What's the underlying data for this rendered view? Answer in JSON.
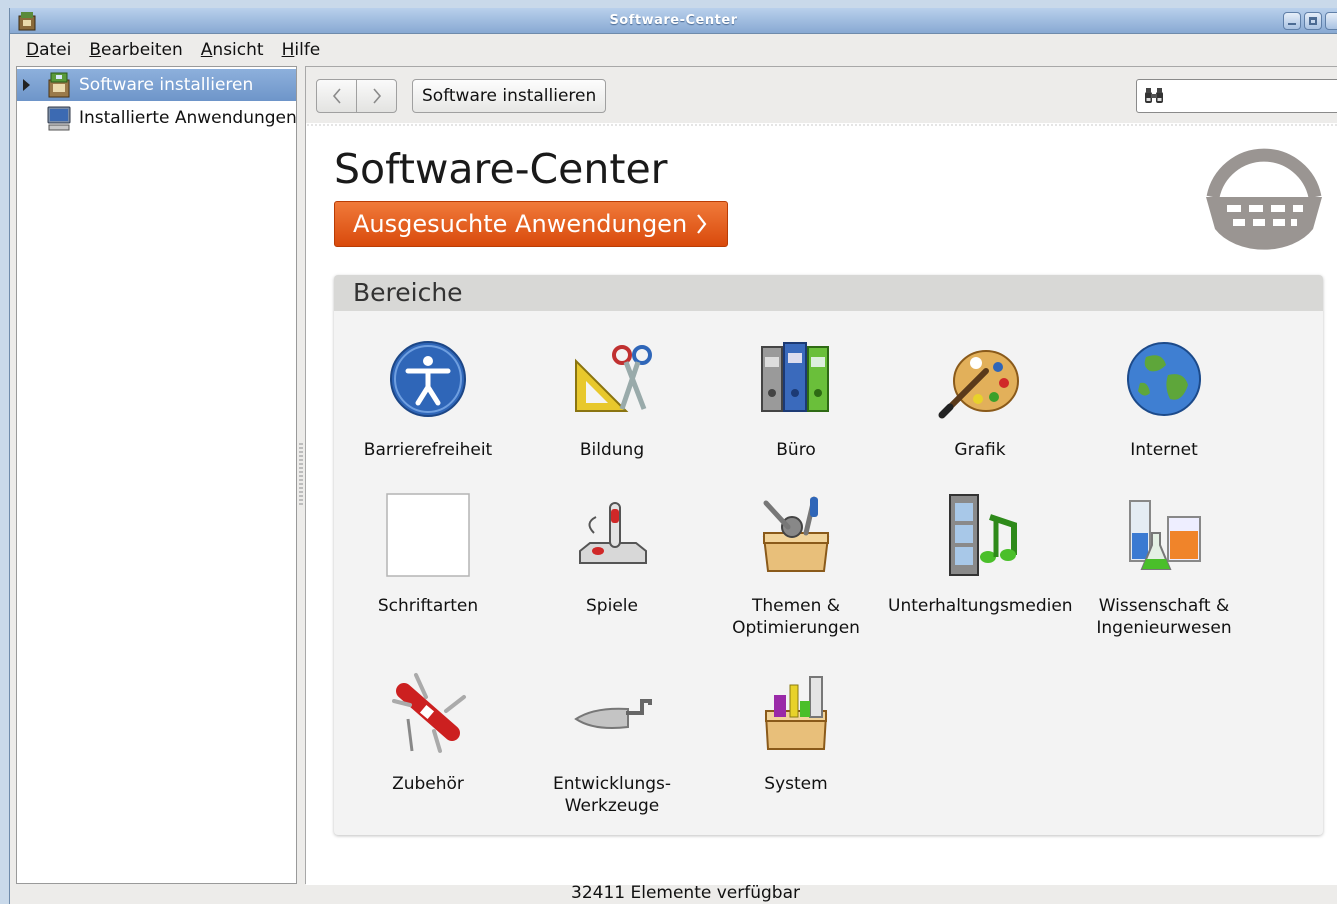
{
  "window": {
    "title": "Software-Center"
  },
  "menubar": {
    "items": [
      {
        "label": "Datei",
        "mnemonic": "D",
        "rest": "atei"
      },
      {
        "label": "Bearbeiten",
        "mnemonic": "B",
        "rest": "earbeiten"
      },
      {
        "label": "Ansicht",
        "mnemonic": "A",
        "rest": "nsicht"
      },
      {
        "label": "Hilfe",
        "mnemonic": "H",
        "rest": "ilfe"
      }
    ]
  },
  "sidebar": {
    "items": [
      {
        "label": "Software installieren",
        "icon": "software-center-icon",
        "selected": true
      },
      {
        "label": "Installierte Anwendungen",
        "icon": "computer-icon",
        "selected": false
      }
    ]
  },
  "toolbar": {
    "back_icon": "chevron-left-icon",
    "forward_icon": "chevron-right-icon",
    "breadcrumb": "Software installieren",
    "search_value": "",
    "search_icon": "binoculars-icon"
  },
  "main": {
    "title": "Software-Center",
    "featured_button": "Ausgesuchte Anwendungen",
    "departments_heading": "Bereiche",
    "categories": [
      {
        "label": "Barrierefreiheit",
        "icon": "accessibility-icon"
      },
      {
        "label": "Bildung",
        "icon": "education-icon"
      },
      {
        "label": "Büro",
        "icon": "office-icon"
      },
      {
        "label": "Grafik",
        "icon": "graphics-icon"
      },
      {
        "label": "Internet",
        "icon": "internet-icon"
      },
      {
        "label": "Schriftarten",
        "icon": "fonts-icon"
      },
      {
        "label": "Spiele",
        "icon": "games-icon"
      },
      {
        "label": "Themen &\nOptimierungen",
        "icon": "themes-icon"
      },
      {
        "label": "Unterhaltungsmedien",
        "icon": "multimedia-icon"
      },
      {
        "label": "Wissenschaft &\nIngenieurwesen",
        "icon": "science-icon"
      },
      {
        "label": "Zubehör",
        "icon": "accessories-icon"
      },
      {
        "label": "Entwicklungs-\nWerkzeuge",
        "icon": "developer-tools-icon"
      },
      {
        "label": "System",
        "icon": "system-icon"
      }
    ]
  },
  "statusbar": {
    "text": "32411 Elemente verfügbar"
  },
  "colors": {
    "accent": "#7aa0d0",
    "featured": "#e45e1c",
    "panel_header": "#d8d8d6"
  }
}
